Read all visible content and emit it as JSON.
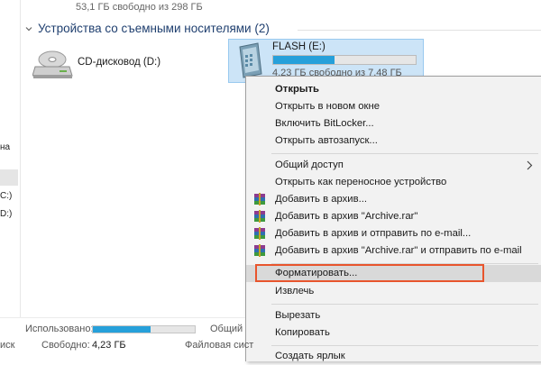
{
  "top_drive": {
    "free_text": "53,1 ГБ свободно из 298 ГБ"
  },
  "group": {
    "title": "Устройства со съемными носителями (2)"
  },
  "cd_drive": {
    "label": "CD-дисковод (D:)"
  },
  "flash_drive": {
    "name": "FLASH (E:)",
    "free_text": "4,23 ГБ свободно из 7,48 ГБ",
    "used_fraction": 0.43
  },
  "sidebar": {
    "labels": [
      "на",
      "C:)",
      "D:)"
    ]
  },
  "context_menu": {
    "items": [
      {
        "id": "open",
        "label": "Открыть",
        "bold": true
      },
      {
        "id": "open-new-window",
        "label": "Открыть в новом окне"
      },
      {
        "id": "bitlocker",
        "label": "Включить BitLocker..."
      },
      {
        "id": "autoplay",
        "label": "Открыть автозапуск..."
      },
      {
        "id": "share",
        "label": "Общий доступ",
        "submenu": true
      },
      {
        "id": "open-portable",
        "label": "Открыть как переносное устройство"
      },
      {
        "id": "add-archive",
        "label": "Добавить в архив...",
        "icon": "winrar-icon"
      },
      {
        "id": "add-archive-rar",
        "label": "Добавить в архив \"Archive.rar\"",
        "icon": "winrar-icon"
      },
      {
        "id": "add-archive-email",
        "label": "Добавить в архив и отправить по e-mail...",
        "icon": "winrar-icon"
      },
      {
        "id": "add-archive-rar-email",
        "label": "Добавить в архив \"Archive.rar\" и отправить по e-mail",
        "icon": "winrar-icon"
      },
      {
        "id": "format",
        "label": "Форматировать...",
        "highlighted": true
      },
      {
        "id": "eject",
        "label": "Извлечь"
      },
      {
        "id": "cut",
        "label": "Вырезать"
      },
      {
        "id": "copy",
        "label": "Копировать"
      },
      {
        "id": "create-shortcut",
        "label": "Создать ярлык"
      }
    ]
  },
  "status_bar": {
    "used_label": "Использовано:",
    "free_label": "Свободно:",
    "free_value": "4,23 ГБ",
    "shared_label": "Общий",
    "fs_label": "Файловая сист",
    "left_cut": "иск",
    "used_fraction": 0.57
  },
  "colors": {
    "accent": "#26a0da",
    "selection": "#cce4f7",
    "highlight_box": "#e8552d"
  }
}
